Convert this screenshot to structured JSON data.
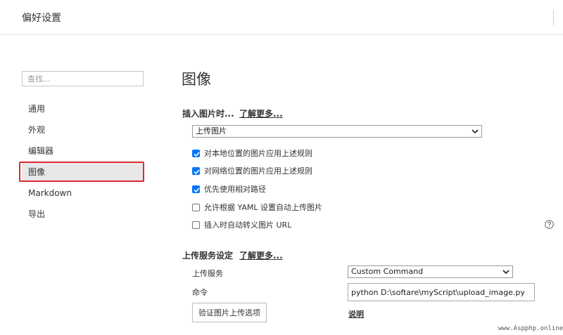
{
  "window": {
    "title": "偏好设置"
  },
  "sidebar": {
    "search_placeholder": "查找...",
    "items": [
      {
        "label": "通用"
      },
      {
        "label": "外观"
      },
      {
        "label": "编辑器"
      },
      {
        "label": "图像",
        "selected": true
      },
      {
        "label": "Markdown"
      },
      {
        "label": "导出"
      }
    ],
    "highlight_color": "#e0282e"
  },
  "main": {
    "heading": "图像",
    "insert_section": {
      "label": "插入图片时...",
      "learn_more": "了解更多...",
      "action_select": "上传图片",
      "checkboxes": [
        {
          "label": "对本地位置的图片应用上述规则",
          "checked": true
        },
        {
          "label": "对网络位置的图片应用上述规则",
          "checked": true
        },
        {
          "label": "优先使用相对路径",
          "checked": true
        },
        {
          "label": "允许根据 YAML 设置自动上传图片",
          "checked": false
        },
        {
          "label": "插入时自动转义图片 URL",
          "checked": false
        }
      ]
    },
    "upload_section": {
      "label": "上传服务设定",
      "learn_more": "了解更多...",
      "service_label": "上传服务",
      "service_value": "Custom Command",
      "command_label": "命令",
      "command_value": "python D:\\softare\\myScript\\upload_image.py",
      "verify_button": "验证图片上传选项",
      "explain_link": "说明"
    }
  },
  "watermark": "www.Aspphp.online",
  "colors": {
    "accent": "#0075ff",
    "nav_selected": "#e8e8e8"
  }
}
